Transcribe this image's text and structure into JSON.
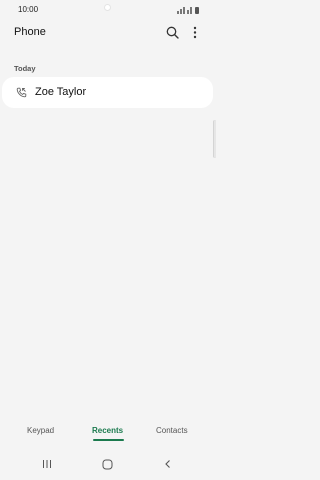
{
  "status_bar": {
    "time": "10:00"
  },
  "header": {
    "title": "Phone"
  },
  "recents": {
    "section_label": "Today",
    "items": [
      {
        "name": "Zoe Taylor"
      }
    ]
  },
  "tabs": [
    {
      "label": "Keypad",
      "active": false
    },
    {
      "label": "Recents",
      "active": true
    },
    {
      "label": "Contacts",
      "active": false
    }
  ],
  "colors": {
    "accent": "#1b7a4e",
    "background": "#f4f4f4",
    "card": "#ffffff"
  },
  "icons": {
    "search": "search-icon",
    "more": "more-options-icon",
    "call": "incoming-call-icon",
    "nav_recents": "recent-apps-icon",
    "nav_home": "home-icon",
    "nav_back": "back-icon"
  }
}
